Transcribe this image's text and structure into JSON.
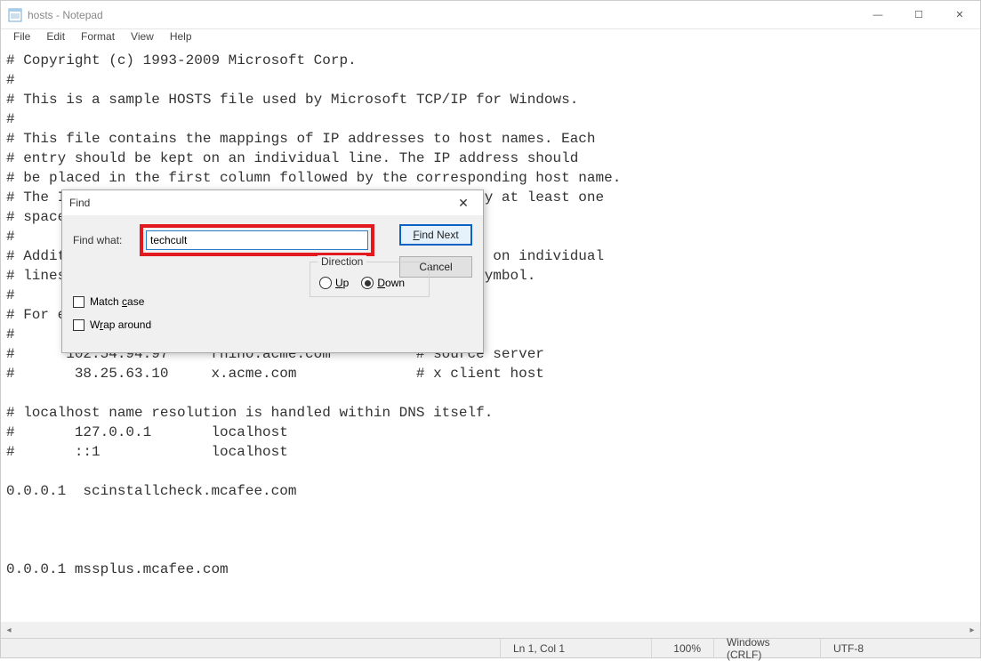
{
  "window": {
    "title": "hosts - Notepad",
    "controls": {
      "minimize": "—",
      "maximize": "☐",
      "close": "✕"
    }
  },
  "menu": {
    "file": "File",
    "edit": "Edit",
    "format": "Format",
    "view": "View",
    "help": "Help"
  },
  "editor_text": "# Copyright (c) 1993-2009 Microsoft Corp.\n#\n# This is a sample HOSTS file used by Microsoft TCP/IP for Windows.\n#\n# This file contains the mappings of IP addresses to host names. Each\n# entry should be kept on an individual line. The IP address should\n# be placed in the first column followed by the corresponding host name.\n# The IP address and the host name should be separated by at least one\n# space.\n#\n# Additionally, comments (such as these) may be inserted on individual\n# lines or following the machine name denoted by a '#' symbol.\n#\n# For example:\n#\n#      102.54.94.97     rhino.acme.com          # source server\n#       38.25.63.10     x.acme.com              # x client host\n\n# localhost name resolution is handled within DNS itself.\n#       127.0.0.1       localhost\n#       ::1             localhost\n\n0.0.0.1  scinstallcheck.mcafee.com\n\n\n\n0.0.0.1 mssplus.mcafee.com",
  "find": {
    "title": "Find",
    "close": "✕",
    "label": "Find what:",
    "value": "techcult",
    "direction_label": "Direction",
    "up": "Up",
    "down": "Down",
    "match_case": "Match case",
    "wrap_around": "Wrap around",
    "find_next": "Find Next",
    "cancel": "Cancel"
  },
  "status": {
    "position": "Ln 1, Col 1",
    "zoom": "100%",
    "eol": "Windows (CRLF)",
    "encoding": "UTF-8"
  }
}
